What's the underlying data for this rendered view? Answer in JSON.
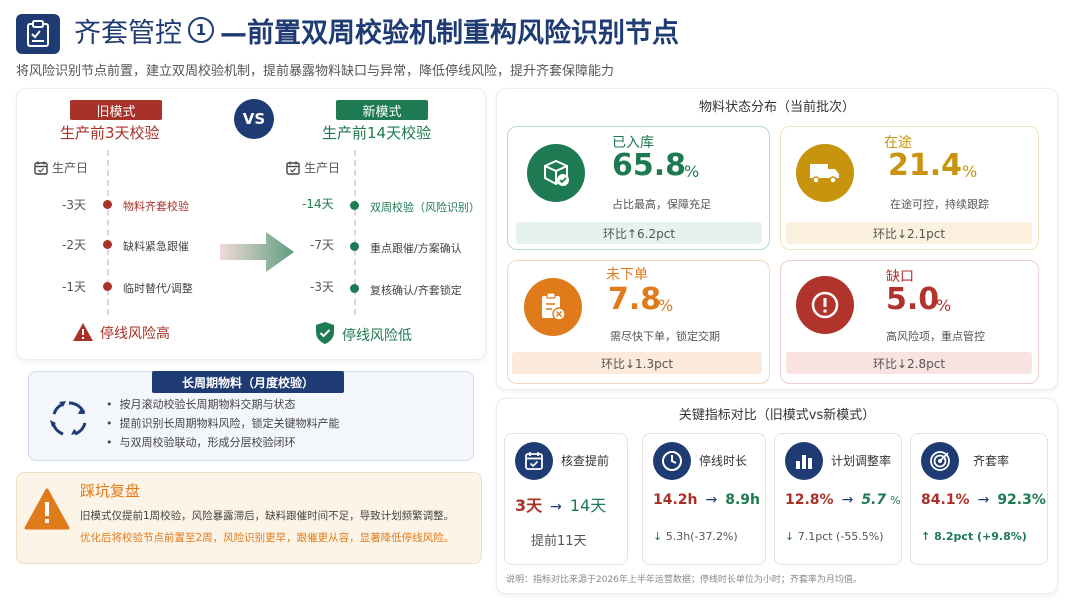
{
  "header": {
    "title_prefix": "齐套管控",
    "title_num": "1",
    "title_main": "—前置双周校验机制重构风险识别节点",
    "subtitle": "将风险识别节点前置，建立双周校验机制，提前暴露物料缺口与异常，降低停线风险，提升齐套保障能力"
  },
  "compare": {
    "vs": "VS",
    "old": {
      "tag": "旧模式",
      "sub": "生产前3天校验",
      "prod_day": "生产日",
      "steps": [
        {
          "day": "-3天",
          "label": "物料齐套校验"
        },
        {
          "day": "-2天",
          "label": "缺料紧急跟催"
        },
        {
          "day": "-1天",
          "label": "临时替代/调整"
        }
      ],
      "risk": "停线风险高"
    },
    "new": {
      "tag": "新模式",
      "sub": "生产前14天校验",
      "prod_day": "生产日",
      "steps": [
        {
          "day": "-14天",
          "label": "双周校验（风险识别）"
        },
        {
          "day": "-7天",
          "label": "重点跟催/方案确认"
        },
        {
          "day": "-3天",
          "label": "复核确认/齐套锁定"
        }
      ],
      "risk": "停线风险低"
    }
  },
  "long_cycle": {
    "title": "长周期物料（月度校验）",
    "bullets": [
      "按月滚动校验长周期物料交期与状态",
      "提前识别长周期物料风险，锁定关键物料产能",
      "与双周校验联动，形成分层校验闭环"
    ]
  },
  "review": {
    "title": "踩坑复盘",
    "line1": "旧模式仅提前1周校验，风险暴露滞后，缺料跟催时间不足，导致计划频繁调整。",
    "line2": "优化后将校验节点前置至2周，风险识别更早，跟催更从容，显著降低停线风险。"
  },
  "status": {
    "title": "物料状态分布（当前批次）",
    "items": [
      {
        "name": "已入库",
        "value": "65.8",
        "unit": "%",
        "desc": "占比最高，保障充足",
        "change": "环比↑6.2pct",
        "color": "#1e7a52",
        "bar": "#e6f2ec",
        "icon": "package-check-icon"
      },
      {
        "name": "在途",
        "value": "21.4",
        "unit": "%",
        "desc": "在途可控，持续跟踪",
        "change": "环比↓2.1pct",
        "color": "#c8940e",
        "bar": "#fbf1de",
        "icon": "truck-icon"
      },
      {
        "name": "未下单",
        "value": "7.8",
        "unit": "%",
        "desc": "需尽快下单，锁定交期",
        "change": "环比↓1.3pct",
        "color": "#e07b1c",
        "bar": "#fcebdc",
        "icon": "clipboard-x-icon"
      },
      {
        "name": "缺口",
        "value": "5.0",
        "unit": "%",
        "desc": "高风险项，重点管控",
        "change": "环比↓2.8pct",
        "color": "#b0342c",
        "bar": "#f8e3e1",
        "icon": "alert-circle-icon"
      }
    ]
  },
  "kpis": {
    "title": "关键指标对比（旧模式vs新模式）",
    "items": [
      {
        "name": "核查提前",
        "old": "3天",
        "new": "14天",
        "old_unit": "",
        "new_unit": "",
        "foot": "提前11天",
        "icon": "calendar-check-icon"
      },
      {
        "name": "停线时长",
        "old": "14.2h",
        "new": "8.9h",
        "old_unit": "",
        "new_unit": "",
        "foot": "5.3h(-37.2%)",
        "icon": "clock-icon"
      },
      {
        "name": "计划调整率",
        "old": "12.8%",
        "new": "5.7",
        "old_unit": "",
        "new_unit": "%",
        "foot": "7.1pct (-55.5%)",
        "icon": "bar-chart-icon"
      },
      {
        "name": "齐套率",
        "old": "84.1%",
        "new": "92.3%",
        "old_unit": "",
        "new_unit": "",
        "foot": "8.2pct (+9.8%)",
        "icon": "target-icon"
      }
    ],
    "note": "说明：指标对比来源于2026年上半年运营数据；停线时长单位为小时；齐套率为月均值。"
  },
  "colors": {
    "navy": "#1f3b73",
    "red": "#a8312a",
    "green": "#1e7a52",
    "orange": "#e07b1c"
  }
}
